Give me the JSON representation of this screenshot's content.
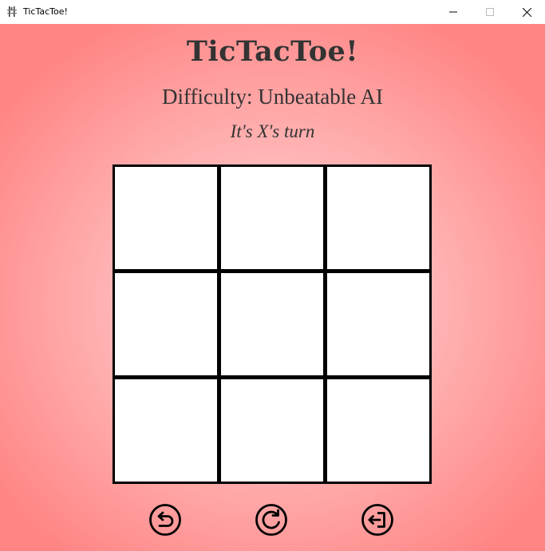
{
  "window": {
    "title": "TicTacToe!",
    "icon": "app-icon",
    "controls": [
      "minimize-icon",
      "maximize-icon",
      "close-icon"
    ]
  },
  "game": {
    "title": "TicTacToe!",
    "difficulty": "Difficulty: Unbeatable AI",
    "turn": "It's X's turn",
    "board": [
      "",
      "",
      "",
      "",
      "",
      "",
      "",
      "",
      ""
    ]
  },
  "controls": {
    "undo": "undo-icon",
    "restart": "restart-icon",
    "exit": "exit-icon"
  },
  "colors": {
    "background_outer": "#ff8585",
    "background_inner": "#ffd4d4",
    "text": "#333333",
    "cell": "#ffffff",
    "cell_border": "#000000"
  }
}
